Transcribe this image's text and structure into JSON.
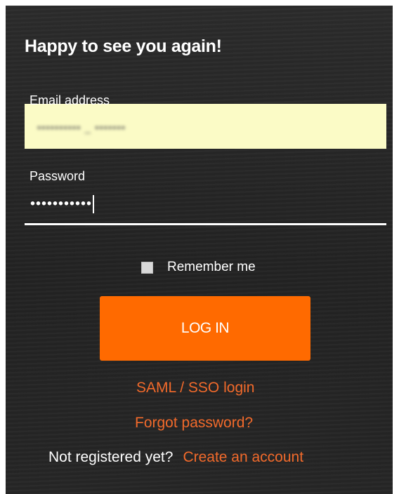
{
  "form": {
    "title": "Happy to see you again!",
    "email": {
      "label": "Email address",
      "value": "•••••••••• _ •••••••"
    },
    "password": {
      "label": "Password",
      "value": "•••••••••••"
    },
    "remember_label": "Remember me",
    "login_label": "LOG IN",
    "saml_link": "SAML / SSO login",
    "forgot_link": "Forgot password?",
    "not_registered": "Not registered yet?",
    "create_account": "Create an account"
  },
  "colors": {
    "accent": "#ff6a00",
    "link": "#f26a2b",
    "autofill": "#fbfbc6",
    "background": "#262626"
  }
}
